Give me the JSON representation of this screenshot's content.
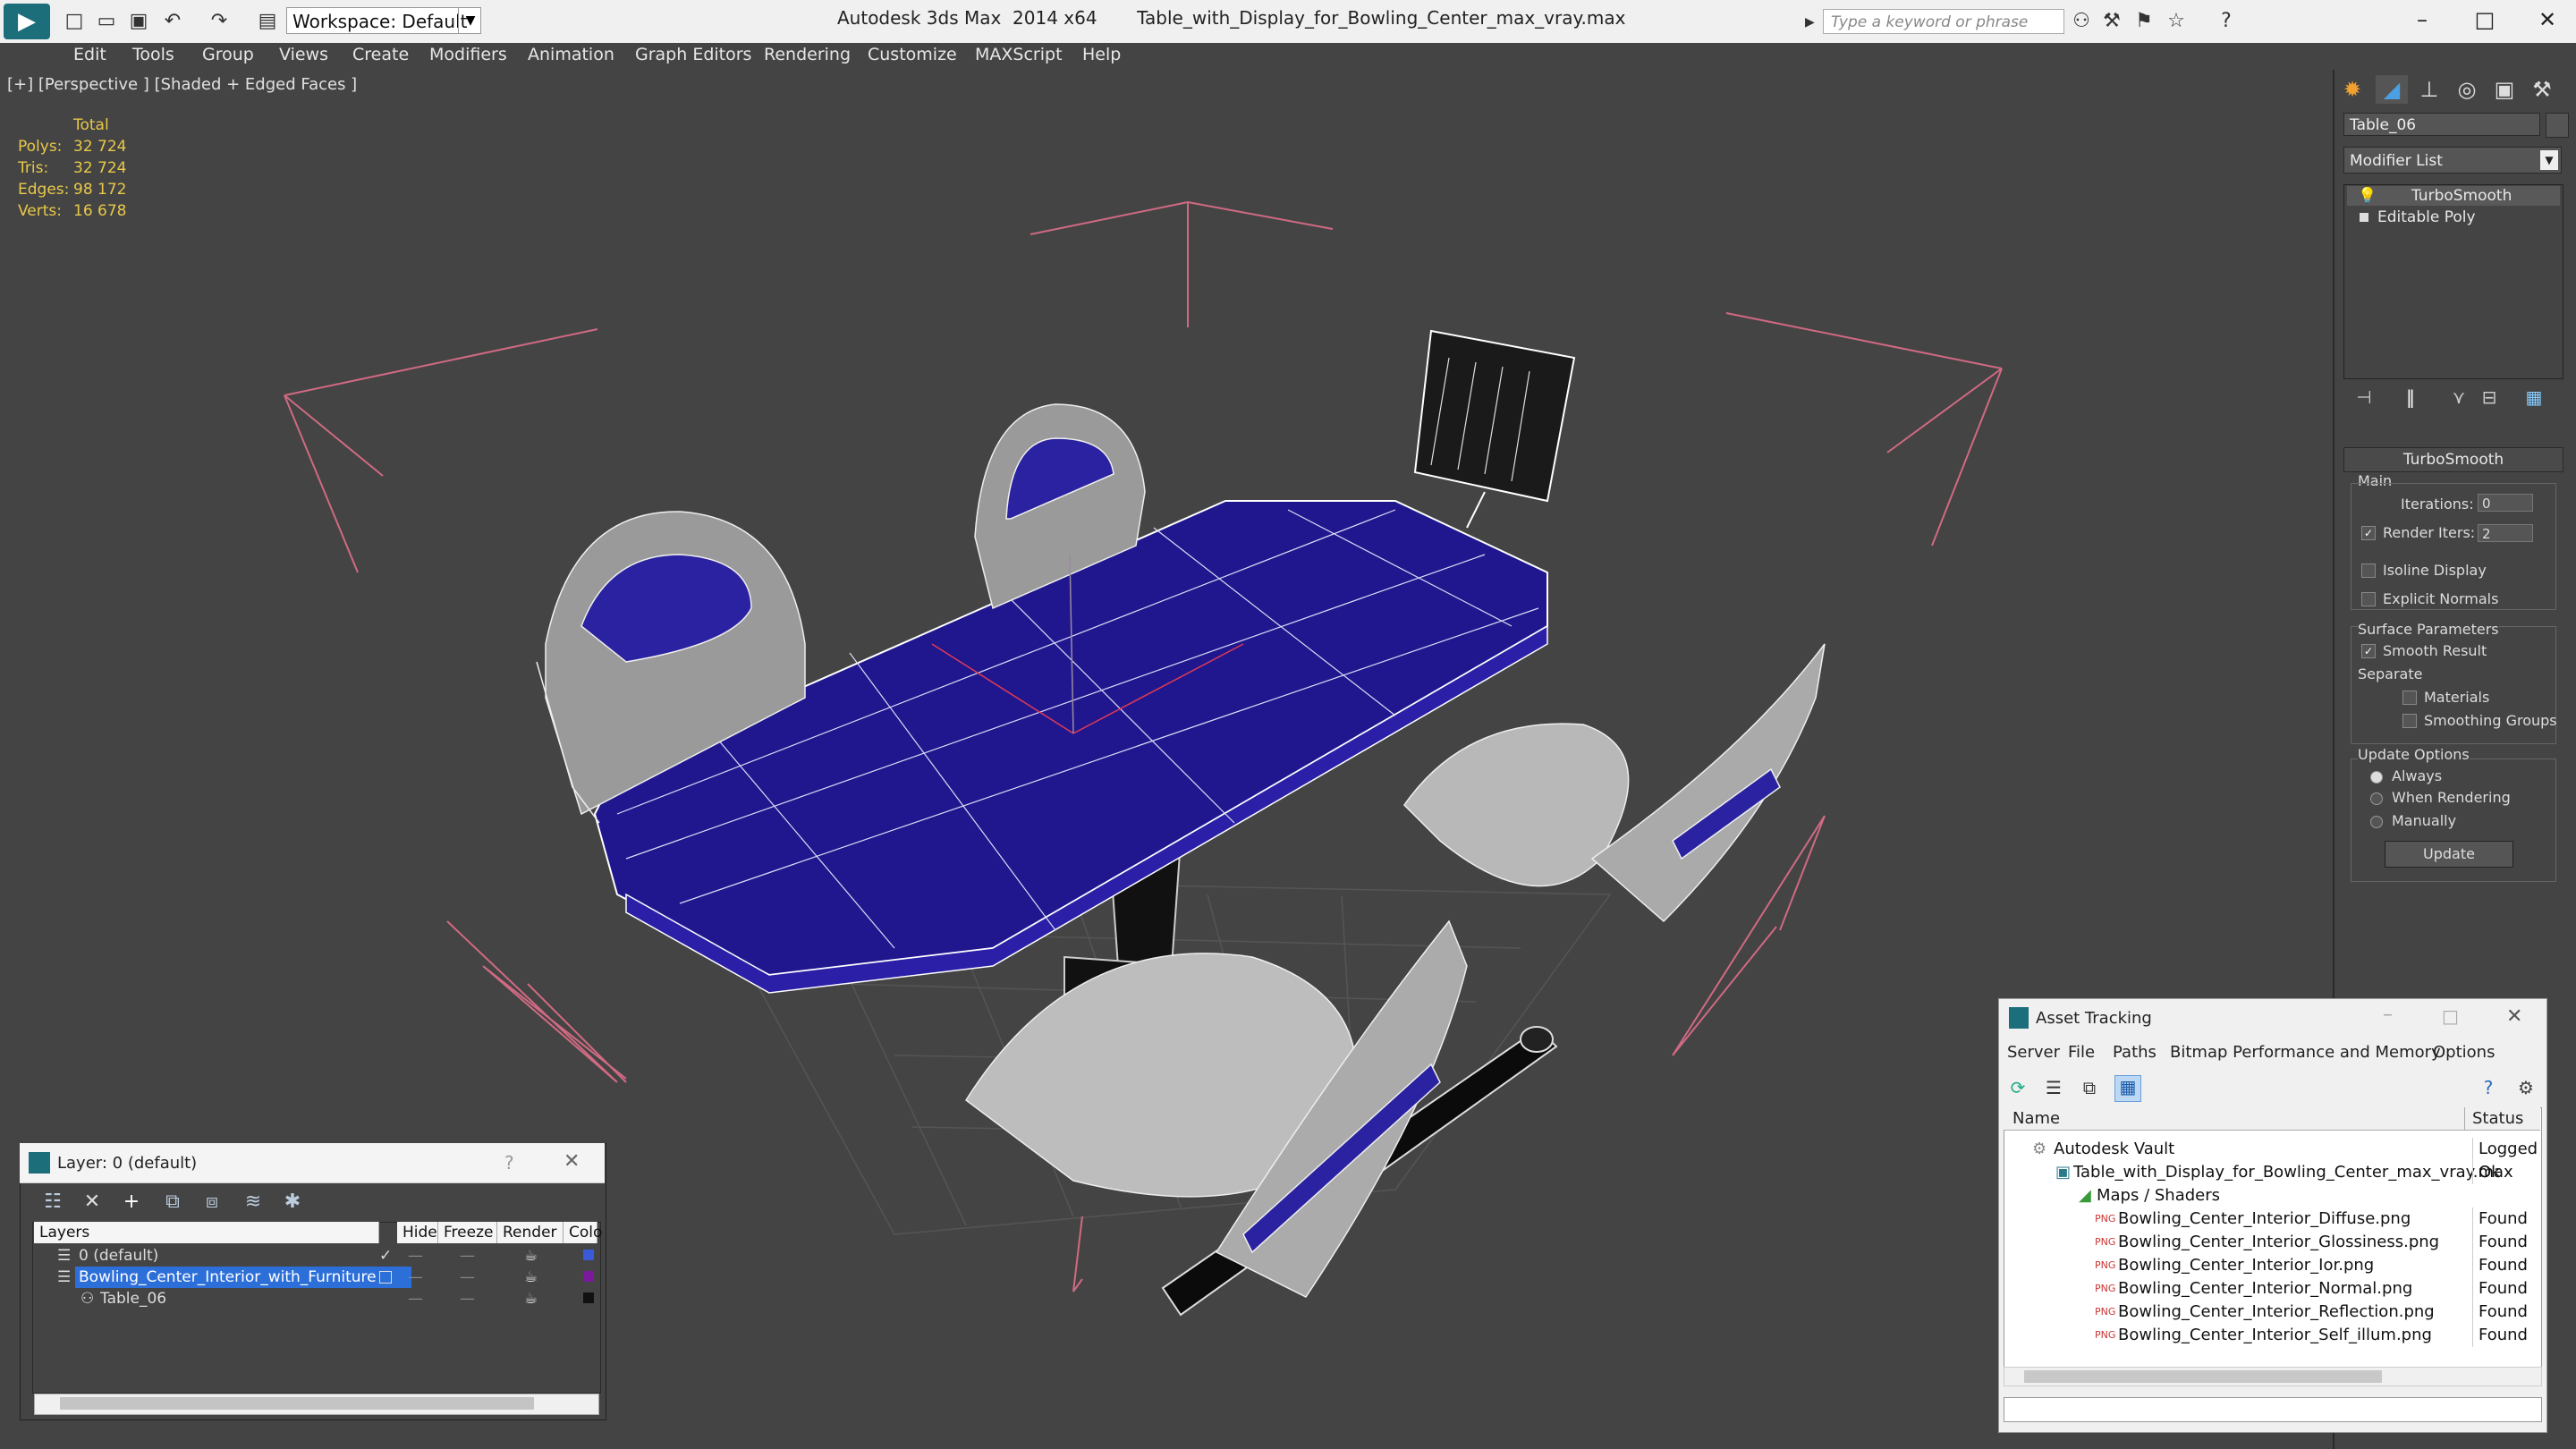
{
  "app": {
    "workspace": "Workspace: Default",
    "title": "Autodesk 3ds Max  2014 x64",
    "file": "Table_with_Display_for_Bowling_Center_max_vray.max",
    "search_placeholder": "Type a keyword or phrase"
  },
  "menu": [
    "Edit",
    "Tools",
    "Group",
    "Views",
    "Create",
    "Modifiers",
    "Animation",
    "Graph Editors",
    "Rendering",
    "Customize",
    "MAXScript",
    "Help"
  ],
  "viewport": {
    "label": "[+] [Perspective ] [Shaded + Edged Faces ]",
    "stats_header": "Total",
    "stats": [
      {
        "label": "Polys:",
        "value": "32 724"
      },
      {
        "label": "Tris:",
        "value": "32 724"
      },
      {
        "label": "Edges:",
        "value": "98 172"
      },
      {
        "label": "Verts:",
        "value": "16 678"
      }
    ]
  },
  "command_panel": {
    "object_name": "Table_06",
    "modifier_list": "Modifier List",
    "stack": [
      "TurboSmooth",
      "Editable Poly"
    ],
    "rollout_title": "TurboSmooth",
    "main_label": "Main",
    "iterations_label": "Iterations:",
    "iterations_value": "0",
    "render_iters_label": "Render Iters:",
    "render_iters_value": "2",
    "isoline": "Isoline Display",
    "explicit": "Explicit Normals",
    "surface_params": "Surface Parameters",
    "smooth_result": "Smooth Result",
    "separate": "Separate",
    "materials": "Materials",
    "smoothing_groups": "Smoothing Groups",
    "update_options": "Update Options",
    "always": "Always",
    "when_rendering": "When Rendering",
    "manually": "Manually",
    "update_button": "Update"
  },
  "layer_dialog": {
    "title": "Layer: 0 (default)",
    "help": "?",
    "columns": [
      "Layers",
      "Hide",
      "Freeze",
      "Render",
      "Colo"
    ],
    "rows": [
      {
        "name": "0 (default)",
        "color": "#3a5ad8"
      },
      {
        "name": "Bowling_Center_Interior_with_Furniture",
        "color": "#7a1a9a"
      },
      {
        "name": "Table_06",
        "color": "#111111"
      }
    ]
  },
  "asset_tracking": {
    "title": "Asset Tracking",
    "menu": [
      "Server",
      "File",
      "Paths",
      "Bitmap Performance and Memory",
      "Options"
    ],
    "columns": [
      "Name",
      "Status"
    ],
    "rows": [
      {
        "name": "Autodesk Vault",
        "status": "Logged O"
      },
      {
        "name": "Table_with_Display_for_Bowling_Center_max_vray.max",
        "status": "Ok"
      },
      {
        "name": "Maps / Shaders",
        "status": ""
      },
      {
        "name": "Bowling_Center_Interior_Diffuse.png",
        "status": "Found"
      },
      {
        "name": "Bowling_Center_Interior_Glossiness.png",
        "status": "Found"
      },
      {
        "name": "Bowling_Center_Interior_Ior.png",
        "status": "Found"
      },
      {
        "name": "Bowling_Center_Interior_Normal.png",
        "status": "Found"
      },
      {
        "name": "Bowling_Center_Interior_Reflection.png",
        "status": "Found"
      },
      {
        "name": "Bowling_Center_Interior_Self_illum.png",
        "status": "Found"
      }
    ]
  }
}
